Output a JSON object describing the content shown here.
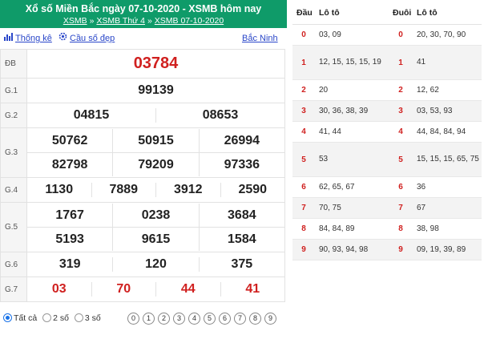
{
  "header": {
    "title": "Xổ số Miền Bắc ngày 07-10-2020 - XSMB hôm nay",
    "crumbs": [
      "XSMB",
      "XSMB Thứ 4",
      "XSMB 07-10-2020"
    ],
    "sep": "»"
  },
  "links": {
    "thong_ke": "Thống kê",
    "cau_so": "Cầu số đẹp",
    "region": "Bắc Ninh"
  },
  "results": {
    "db_label": "ĐB",
    "db": "03784",
    "g1_label": "G.1",
    "g1": "99139",
    "g2_label": "G.2",
    "g2": [
      "04815",
      "08653"
    ],
    "g3_label": "G.3",
    "g3": [
      "50762",
      "50915",
      "26994",
      "82798",
      "79209",
      "97336"
    ],
    "g4_label": "G.4",
    "g4": [
      "1130",
      "7889",
      "3912",
      "2590"
    ],
    "g5_label": "G.5",
    "g5": [
      "1767",
      "0238",
      "3684",
      "5193",
      "9615",
      "1584"
    ],
    "g6_label": "G.6",
    "g6": [
      "319",
      "120",
      "375"
    ],
    "g7_label": "G.7",
    "g7": [
      "03",
      "70",
      "44",
      "41"
    ]
  },
  "filters": {
    "options": [
      "Tất cả",
      "2 số",
      "3 số"
    ],
    "selected": "Tất cả",
    "digits": [
      "0",
      "1",
      "2",
      "3",
      "4",
      "5",
      "6",
      "7",
      "8",
      "9"
    ]
  },
  "loto": {
    "headers": {
      "dau": "Đầu",
      "loto1": "Lô tô",
      "duoi": "Đuôi",
      "loto2": "Lô tô"
    },
    "rows": [
      {
        "dau": "0",
        "dau_vals": "03, 09",
        "duoi": "0",
        "duoi_vals": "20, 30, 70, 90"
      },
      {
        "dau": "1",
        "dau_vals": "12, 15, 15, 15, 19",
        "duoi": "1",
        "duoi_vals": "41"
      },
      {
        "dau": "2",
        "dau_vals": "20",
        "duoi": "2",
        "duoi_vals": "12, 62"
      },
      {
        "dau": "3",
        "dau_vals": "30, 36, 38, 39",
        "duoi": "3",
        "duoi_vals": "03, 53, 93"
      },
      {
        "dau": "4",
        "dau_vals": "41, 44",
        "duoi": "4",
        "duoi_vals": "44, 84, 84, 94"
      },
      {
        "dau": "5",
        "dau_vals": "53",
        "duoi": "5",
        "duoi_vals": "15, 15, 15, 65, 75"
      },
      {
        "dau": "6",
        "dau_vals": "62, 65, 67",
        "duoi": "6",
        "duoi_vals": "36"
      },
      {
        "dau": "7",
        "dau_vals": "70, 75",
        "duoi": "7",
        "duoi_vals": "67"
      },
      {
        "dau": "8",
        "dau_vals": "84, 84, 89",
        "duoi": "8",
        "duoi_vals": "38, 98"
      },
      {
        "dau": "9",
        "dau_vals": "90, 93, 94, 98",
        "duoi": "9",
        "duoi_vals": "09, 19, 39, 89"
      }
    ]
  },
  "colors": {
    "header_bg": "#0f9b69",
    "accent_red": "#d0201f",
    "link_blue": "#2a47c9"
  }
}
